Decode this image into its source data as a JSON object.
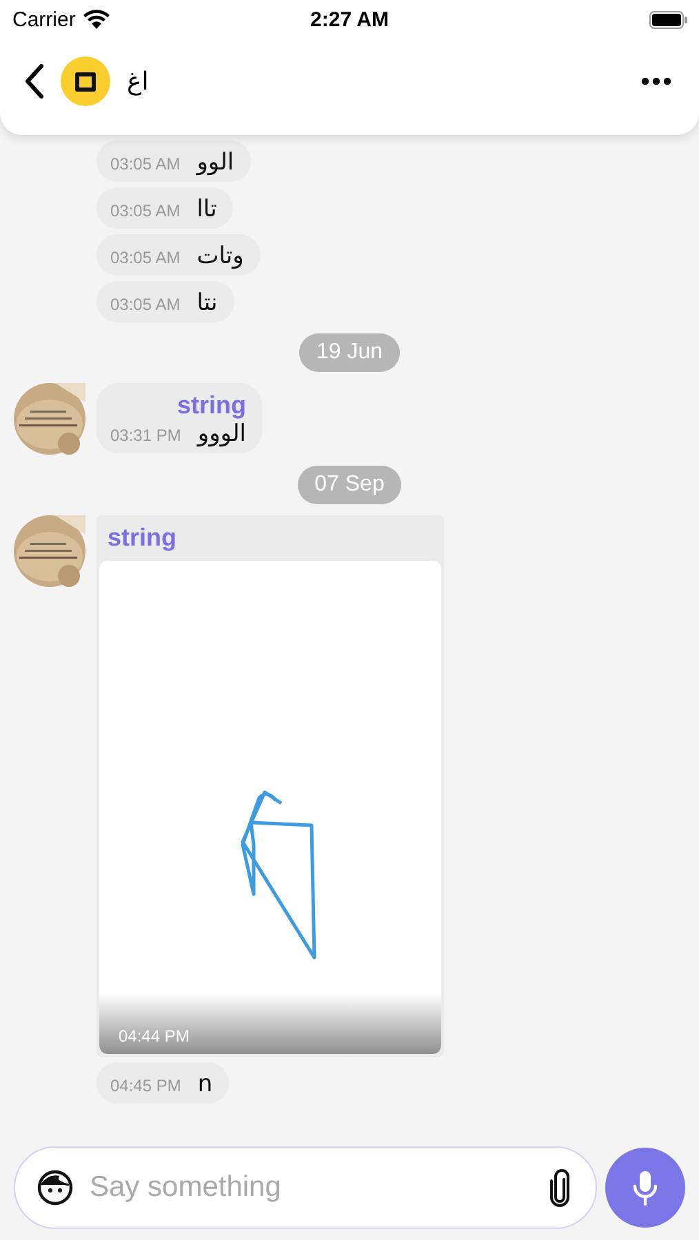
{
  "status_bar": {
    "carrier": "Carrier",
    "time": "2:27 AM"
  },
  "header": {
    "title": "اغ"
  },
  "messages": [
    {
      "kind": "text",
      "text": "الوو",
      "time": "03:05 AM"
    },
    {
      "kind": "text",
      "text": "تاا",
      "time": "03:05 AM"
    },
    {
      "kind": "text",
      "text": "وتات",
      "time": "03:05 AM"
    },
    {
      "kind": "text",
      "text": "نتا",
      "time": "03:05 AM"
    },
    {
      "kind": "date",
      "text": "19 Jun"
    },
    {
      "kind": "text",
      "sender": "string",
      "text": "الووو",
      "time": "03:31 PM"
    },
    {
      "kind": "date",
      "text": "07 Sep"
    },
    {
      "sender": "string",
      "time": "04:44 PM"
    },
    {
      "kind": "text",
      "text": "n",
      "time": "04:45 PM"
    }
  ],
  "composer": {
    "placeholder": "Say something"
  }
}
